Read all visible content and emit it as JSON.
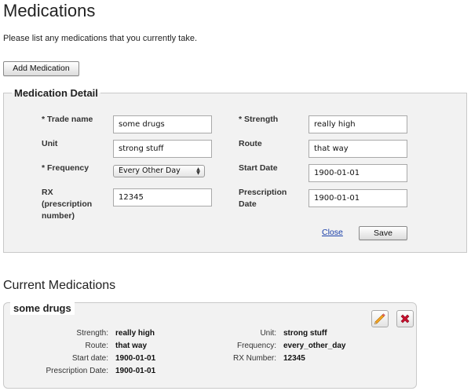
{
  "header": {
    "title": "Medications",
    "intro": "Please list any medications that you currently take.",
    "add_button": "Add Medication"
  },
  "detail": {
    "legend": "Medication Detail",
    "fields": {
      "trade_name": {
        "label": "* Trade name",
        "value": "some drugs"
      },
      "strength": {
        "label": "* Strength",
        "value": "really high"
      },
      "unit": {
        "label": "Unit",
        "value": "strong stuff"
      },
      "route": {
        "label": "Route",
        "value": "that way"
      },
      "frequency": {
        "label": "* Frequency",
        "value": "Every Other Day"
      },
      "start_date": {
        "label": "Start Date",
        "value": "1900-01-01"
      },
      "rx": {
        "label_line1": "RX",
        "label_line2": "(prescription",
        "label_line3": "number)",
        "value": "12345"
      },
      "prescription_date": {
        "label_line1": "Prescription",
        "label_line2": "Date",
        "value": "1900-01-01"
      }
    },
    "close_link": "Close",
    "save_button": "Save"
  },
  "current": {
    "title": "Current Medications",
    "card": {
      "name": "some drugs",
      "left": [
        {
          "label": "Strength:",
          "value": "really high"
        },
        {
          "label": "Route:",
          "value": "that way"
        },
        {
          "label": "Start date:",
          "value": "1900-01-01"
        },
        {
          "label": "Prescription Date:",
          "value": "1900-01-01"
        }
      ],
      "right": [
        {
          "label": "Unit:",
          "value": "strong stuff"
        },
        {
          "label": "Frequency:",
          "value": "every_other_day"
        },
        {
          "label": "RX Number:",
          "value": "12345"
        }
      ]
    }
  },
  "icons": {
    "edit": "pencil-icon",
    "delete": "delete-x-icon",
    "select": "select-arrows-icon"
  },
  "colors": {
    "link": "#1a3fa8",
    "delete_red": "#c8102e",
    "panel_bg": "#f2f2f2"
  }
}
